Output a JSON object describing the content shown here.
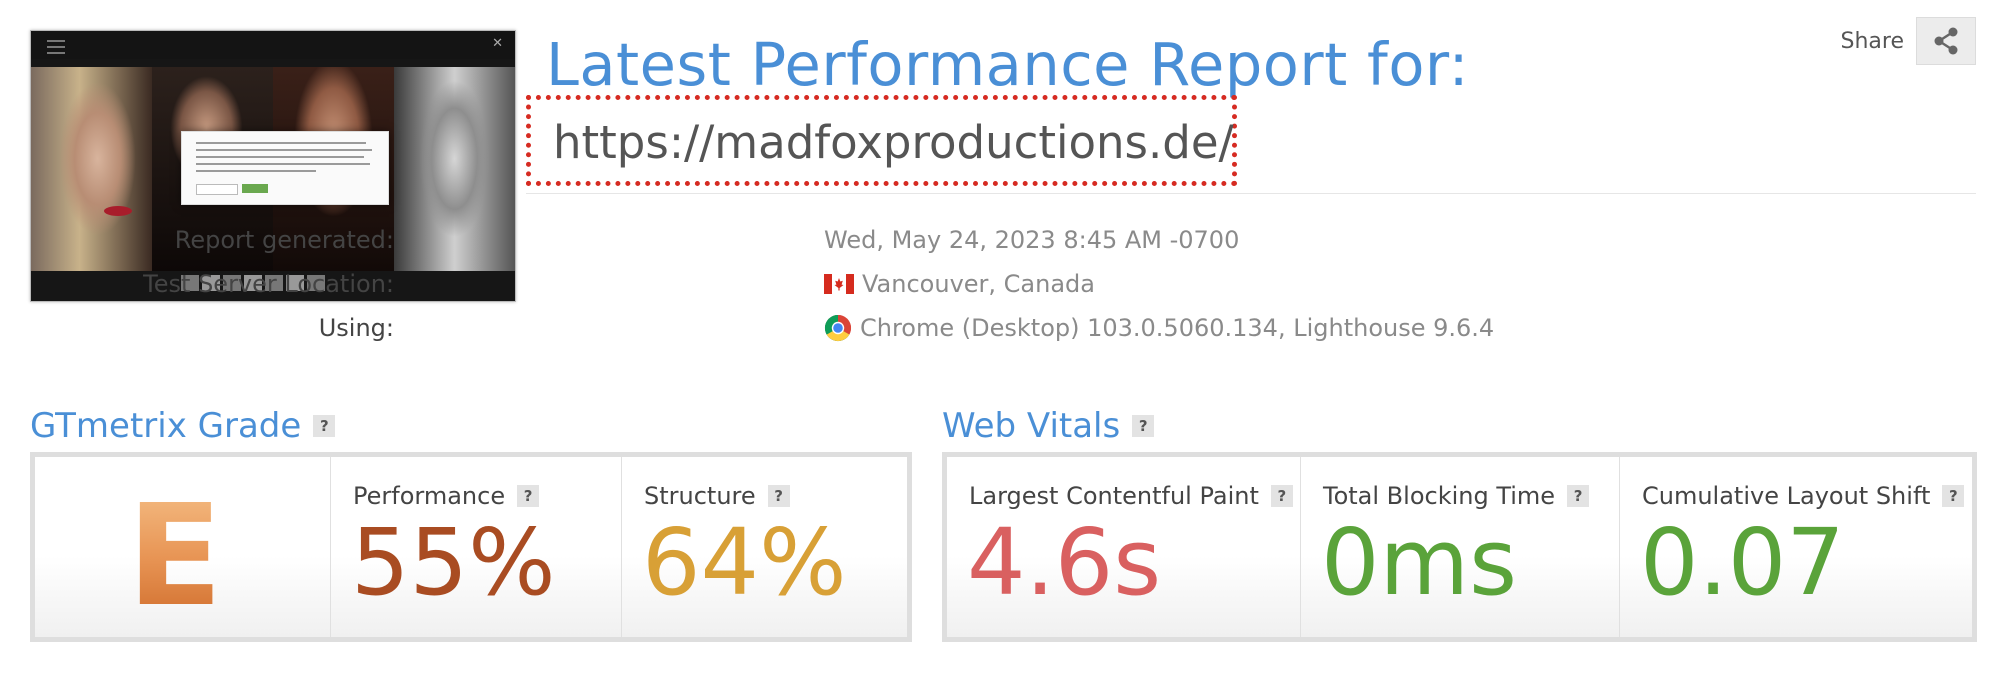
{
  "header": {
    "title": "Latest Performance Report for:",
    "url": "https://madfoxproductions.de/",
    "share_label": "Share"
  },
  "meta": {
    "report_generated": {
      "label": "Report generated:",
      "value": "Wed, May 24, 2023 8:45 AM -0700"
    },
    "server_location": {
      "label": "Test Server Location:",
      "value": "Vancouver, Canada",
      "icon": "canada-flag-icon"
    },
    "using": {
      "label": "Using:",
      "value": "Chrome (Desktop) 103.0.5060.134, Lighthouse 9.6.4",
      "icon": "chrome-icon"
    }
  },
  "gtmetrix_grade": {
    "title": "GTmetrix Grade",
    "help": "?",
    "grade": "E",
    "performance": {
      "label": "Performance",
      "value": "55%",
      "color": "#a94c22"
    },
    "structure": {
      "label": "Structure",
      "value": "64%",
      "color": "#d8a036"
    }
  },
  "web_vitals": {
    "title": "Web Vitals",
    "help": "?",
    "lcp": {
      "label": "Largest Contentful Paint",
      "value": "4.6s",
      "color": "#d96060"
    },
    "tbt": {
      "label": "Total Blocking Time",
      "value": "0ms",
      "color": "#5aa33a"
    },
    "cls": {
      "label": "Cumulative Layout Shift",
      "value": "0.07",
      "color": "#5aa33a"
    }
  },
  "colors": {
    "accent_blue": "#4a8fd6",
    "highlight_red": "#d62b22"
  }
}
